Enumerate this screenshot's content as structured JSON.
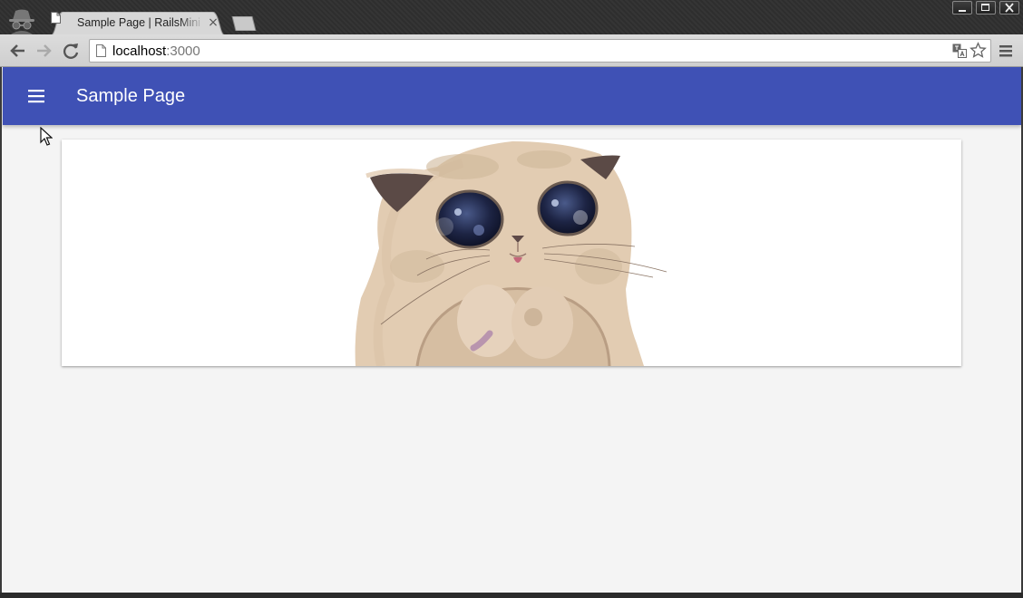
{
  "browser": {
    "tab": {
      "title": "Sample Page | RailsMini",
      "close_glyph": "×"
    },
    "address": {
      "host": "localhost",
      "port": ":3000"
    },
    "icons": {
      "incognito": "incognito-icon",
      "back": "back-arrow-icon",
      "forward": "forward-arrow-icon",
      "reload": "reload-icon",
      "page": "page-icon",
      "translate": "translate-icon",
      "bookmark": "star-icon",
      "menu": "chrome-menu-icon",
      "minimize": "minimize-icon",
      "maximize": "maximize-icon",
      "close": "close-icon"
    }
  },
  "app": {
    "title": "Sample Page",
    "icons": {
      "menu": "hamburger-menu-icon"
    }
  },
  "card": {
    "image": "cat-illustration"
  },
  "colors": {
    "appbar": "#3f51b5",
    "page_background": "#f4f4f4",
    "card_background": "#ffffff"
  }
}
